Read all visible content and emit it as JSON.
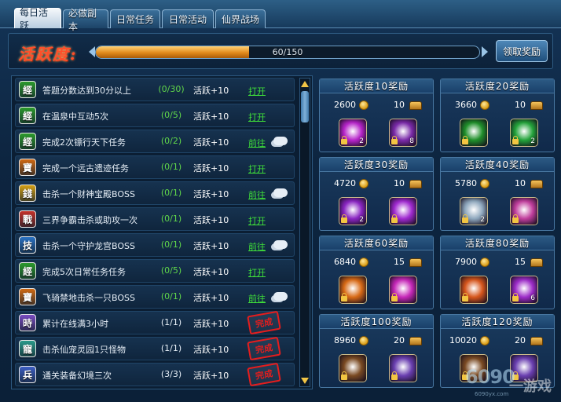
{
  "tabs": [
    {
      "label": "每日活跃",
      "active": true
    },
    {
      "label": "必做副本",
      "active": false
    },
    {
      "label": "日常任务",
      "active": false
    },
    {
      "label": "日常活动",
      "active": false
    },
    {
      "label": "仙界战场",
      "active": false
    }
  ],
  "activity": {
    "title": "活跃度:",
    "progress_text": "60/150",
    "current": 60,
    "max": 150,
    "claim_label": "领取奖励"
  },
  "tasks": [
    {
      "icon": "經",
      "icon_color": "#2c9a2c",
      "name": "答题分数达到30分以上",
      "progress": "(0/30)",
      "points": "活跃+10",
      "action": "打开",
      "cloud": false,
      "done": false
    },
    {
      "icon": "經",
      "icon_color": "#2c9a2c",
      "name": "在温泉中互动5次",
      "progress": "(0/5)",
      "points": "活跃+10",
      "action": "打开",
      "cloud": false,
      "done": false
    },
    {
      "icon": "經",
      "icon_color": "#2c9a2c",
      "name": "完成2次镖行天下任务",
      "progress": "(0/2)",
      "points": "活跃+10",
      "action": "前往",
      "cloud": true,
      "done": false
    },
    {
      "icon": "寶",
      "icon_color": "#d06a14",
      "name": "完成一个远古遗迹任务",
      "progress": "(0/1)",
      "points": "活跃+10",
      "action": "打开",
      "cloud": false,
      "done": false
    },
    {
      "icon": "錢",
      "icon_color": "#d4a015",
      "name": "击杀一个财神宝殿BOSS",
      "progress": "(0/1)",
      "points": "活跃+10",
      "action": "前往",
      "cloud": true,
      "done": false
    },
    {
      "icon": "戰",
      "icon_color": "#c4322a",
      "name": "三界争霸击杀或助攻一次",
      "progress": "(0/1)",
      "points": "活跃+10",
      "action": "打开",
      "cloud": false,
      "done": false
    },
    {
      "icon": "技",
      "icon_color": "#2a72c4",
      "name": "击杀一个守护龙宫BOSS",
      "progress": "(0/1)",
      "points": "活跃+10",
      "action": "前往",
      "cloud": true,
      "done": false
    },
    {
      "icon": "經",
      "icon_color": "#2c9a2c",
      "name": "完成5次日常任务任务",
      "progress": "(0/5)",
      "points": "活跃+10",
      "action": "打开",
      "cloud": false,
      "done": false
    },
    {
      "icon": "寶",
      "icon_color": "#d06a14",
      "name": "飞骑禁地击杀一只BOSS",
      "progress": "(0/1)",
      "points": "活跃+10",
      "action": "前往",
      "cloud": true,
      "done": false
    },
    {
      "icon": "時",
      "icon_color": "#7a4cc2",
      "name": "累计在线满3小时",
      "progress": "(1/1)",
      "points": "活跃+10",
      "action": "完成",
      "cloud": false,
      "done": true
    },
    {
      "icon": "寵",
      "icon_color": "#2a9a8a",
      "name": "击杀仙宠灵园1只怪物",
      "progress": "(1/1)",
      "points": "活跃+10",
      "action": "完成",
      "cloud": false,
      "done": true
    },
    {
      "icon": "兵",
      "icon_color": "#3d5fc4",
      "name": "通关装备幻境三次",
      "progress": "(3/3)",
      "points": "活跃+10",
      "action": "完成",
      "cloud": false,
      "done": true
    }
  ],
  "rewards": [
    {
      "title": "活跃度10奖励",
      "gold": "2600",
      "count": "10",
      "items": [
        {
          "color": "#b624c9",
          "qty": "2"
        },
        {
          "color": "#7a2aa8",
          "qty": "8"
        }
      ]
    },
    {
      "title": "活跃度20奖励",
      "gold": "3660",
      "count": "10",
      "items": [
        {
          "color": "#1f8f2a",
          "qty": ""
        },
        {
          "color": "#23a33a",
          "qty": "2"
        }
      ]
    },
    {
      "title": "活跃度30奖励",
      "gold": "4720",
      "count": "10",
      "items": [
        {
          "color": "#8a26c2",
          "qty": "2"
        },
        {
          "color": "#a02ad0",
          "qty": ""
        }
      ]
    },
    {
      "title": "活跃度40奖励",
      "gold": "5780",
      "count": "10",
      "items": [
        {
          "color": "#8ea7bd",
          "qty": "2"
        },
        {
          "color": "#c13f9d",
          "qty": ""
        }
      ]
    },
    {
      "title": "活跃度60奖励",
      "gold": "6840",
      "count": "15",
      "items": [
        {
          "color": "#d86a16",
          "qty": ""
        },
        {
          "color": "#c628b8",
          "qty": ""
        }
      ]
    },
    {
      "title": "活跃度80奖励",
      "gold": "7900",
      "count": "15",
      "items": [
        {
          "color": "#d6561c",
          "qty": ""
        },
        {
          "color": "#9d2cc8",
          "qty": "6"
        }
      ]
    },
    {
      "title": "活跃度100奖励",
      "gold": "8960",
      "count": "20",
      "items": [
        {
          "color": "#7a4a22",
          "qty": ""
        },
        {
          "color": "#6a3fb0",
          "qty": ""
        }
      ]
    },
    {
      "title": "活跃度120奖励",
      "gold": "10020",
      "count": "20",
      "items": [
        {
          "color": "#7a4a22",
          "qty": ""
        },
        {
          "color": "#6a3fb0",
          "qty": ""
        }
      ]
    }
  ],
  "watermark": {
    "big": "6090",
    "small": "一游戏",
    "url": "6090yx.com"
  }
}
